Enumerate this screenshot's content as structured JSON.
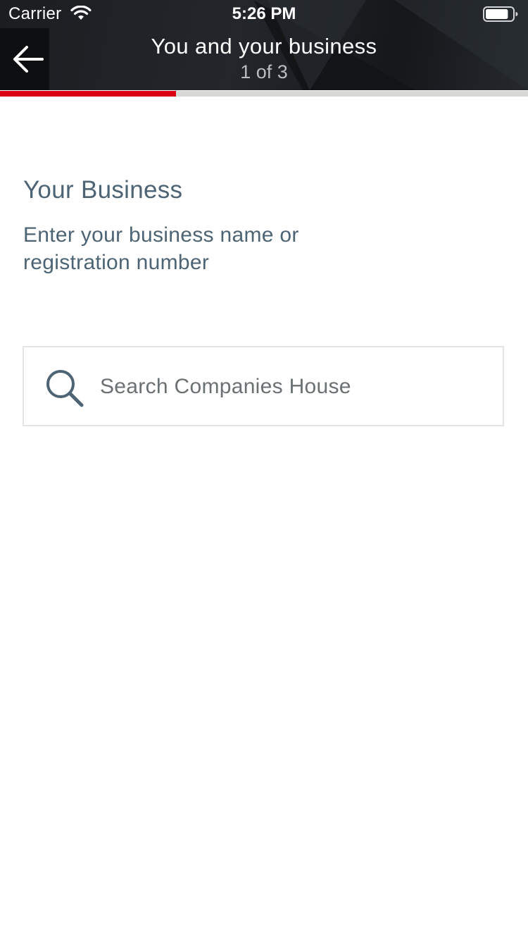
{
  "status_bar": {
    "carrier": "Carrier",
    "time": "5:26 PM",
    "battery_level": 0.85
  },
  "nav": {
    "title": "You and your business",
    "step": "1 of 3",
    "progress": 0.333
  },
  "content": {
    "section_title": "Your Business",
    "section_description": "Enter your business name or registration number",
    "search": {
      "placeholder": "Search Companies House",
      "value": ""
    }
  },
  "colors": {
    "accent_red": "#db0011",
    "header_dark": "#1b1d20",
    "text_slate": "#4d6474"
  }
}
